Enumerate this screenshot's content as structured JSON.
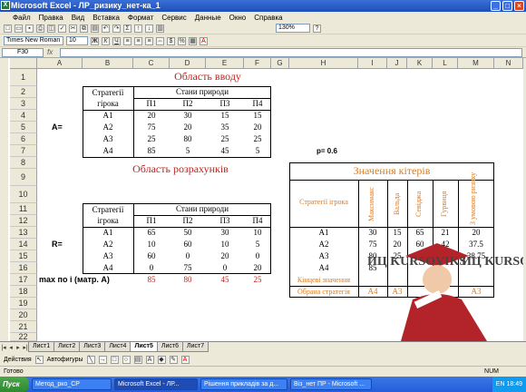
{
  "window": {
    "title": "Microsoft Excel - ЛР_ризику_нет-ка_1"
  },
  "menu": [
    "Файл",
    "Правка",
    "Вид",
    "Вставка",
    "Формат",
    "Сервис",
    "Данные",
    "Окно",
    "Справка"
  ],
  "toolbar": {
    "zoom": "130%",
    "font_name": "Times New Roman",
    "font_size": "10",
    "bold": "Ж",
    "italic": "К",
    "underline": "Ч"
  },
  "formula_bar": {
    "name_box": "F30",
    "fx": "fx",
    "content": ""
  },
  "columns": [
    "A",
    "B",
    "C",
    "D",
    "E",
    "F",
    "G",
    "H",
    "I",
    "J",
    "K",
    "L",
    "M",
    "N"
  ],
  "rows": [
    "1",
    "2",
    "3",
    "4",
    "5",
    "6",
    "7",
    "8",
    "9",
    "10",
    "11",
    "12",
    "13",
    "14",
    "15",
    "16",
    "17",
    "18",
    "19",
    "20",
    "21",
    "22",
    "23"
  ],
  "input": {
    "title": "Область вводу",
    "strategies_header": [
      "Стратегії",
      "гірока"
    ],
    "states_header": "Стани природи",
    "states": [
      "П1",
      "П2",
      "П3",
      "П4"
    ],
    "matrix_label": "A=",
    "rows": [
      {
        "s": "A1",
        "v": [
          "20",
          "30",
          "15",
          "15"
        ]
      },
      {
        "s": "A2",
        "v": [
          "75",
          "20",
          "35",
          "20"
        ]
      },
      {
        "s": "A3",
        "v": [
          "25",
          "80",
          "25",
          "25"
        ]
      },
      {
        "s": "A4",
        "v": [
          "85",
          "5",
          "45",
          "5"
        ]
      }
    ],
    "p_label": "p= 0.6"
  },
  "calc": {
    "title": "Область розрахунків",
    "strategies_header": [
      "Стратегії",
      "ігрока"
    ],
    "states_header": "Стани природи",
    "states": [
      "П1",
      "П2",
      "П3",
      "П4"
    ],
    "matrix_label": "R=",
    "rows": [
      {
        "s": "A1",
        "v": [
          "65",
          "50",
          "30",
          "10"
        ]
      },
      {
        "s": "A2",
        "v": [
          "10",
          "60",
          "10",
          "5"
        ]
      },
      {
        "s": "A3",
        "v": [
          "60",
          "0",
          "20",
          "0"
        ]
      },
      {
        "s": "A4",
        "v": [
          "0",
          "75",
          "0",
          "20"
        ]
      }
    ],
    "max_label": "max по i (матр. А)",
    "max_values": [
      "85",
      "80",
      "45",
      "25"
    ]
  },
  "criteria": {
    "title": "Значення кітерів",
    "strategy_label": "Стратегії ігрока",
    "headers": [
      "Максимакс",
      "Вальда",
      "Севіджа",
      "Гурвиця",
      "З умовою ризику"
    ],
    "rows": [
      {
        "s": "A1",
        "v": [
          "30",
          "15",
          "65",
          "21",
          "20"
        ]
      },
      {
        "s": "A2",
        "v": [
          "75",
          "20",
          "60",
          "42",
          "37.5"
        ]
      },
      {
        "s": "A3",
        "v": [
          "80",
          "25",
          "",
          "",
          "38.75"
        ]
      },
      {
        "s": "A4",
        "v": [
          "85",
          "",
          "",
          "",
          ""
        ]
      }
    ],
    "final_label": "Кінцеві значення",
    "chosen_label": "Обрана стратегія",
    "chosen": [
      "A4",
      "A3",
      "",
      "",
      "A3"
    ]
  },
  "watermark": {
    "brand": "ИЦ KURSOVIKS"
  },
  "sheet_tabs": [
    "Лист1",
    "Лист2",
    "Лист3",
    "Лист4",
    "Лист5",
    "Лист6",
    "Лист7"
  ],
  "active_tab": "Лист5",
  "draw_toolbar": {
    "actions": "Действия",
    "autoshapes": "Автофигуры"
  },
  "status": {
    "text": "Готово",
    "num": "NUM"
  },
  "taskbar": {
    "start": "Пуск",
    "tasks": [
      "Метод_рко_СР",
      "Microsoft Excel - ЛР...",
      "Рішення прикладів за д...",
      "Віз_нет ПР - Microsoft ..."
    ],
    "lang": "EN",
    "clock": "18:49"
  }
}
